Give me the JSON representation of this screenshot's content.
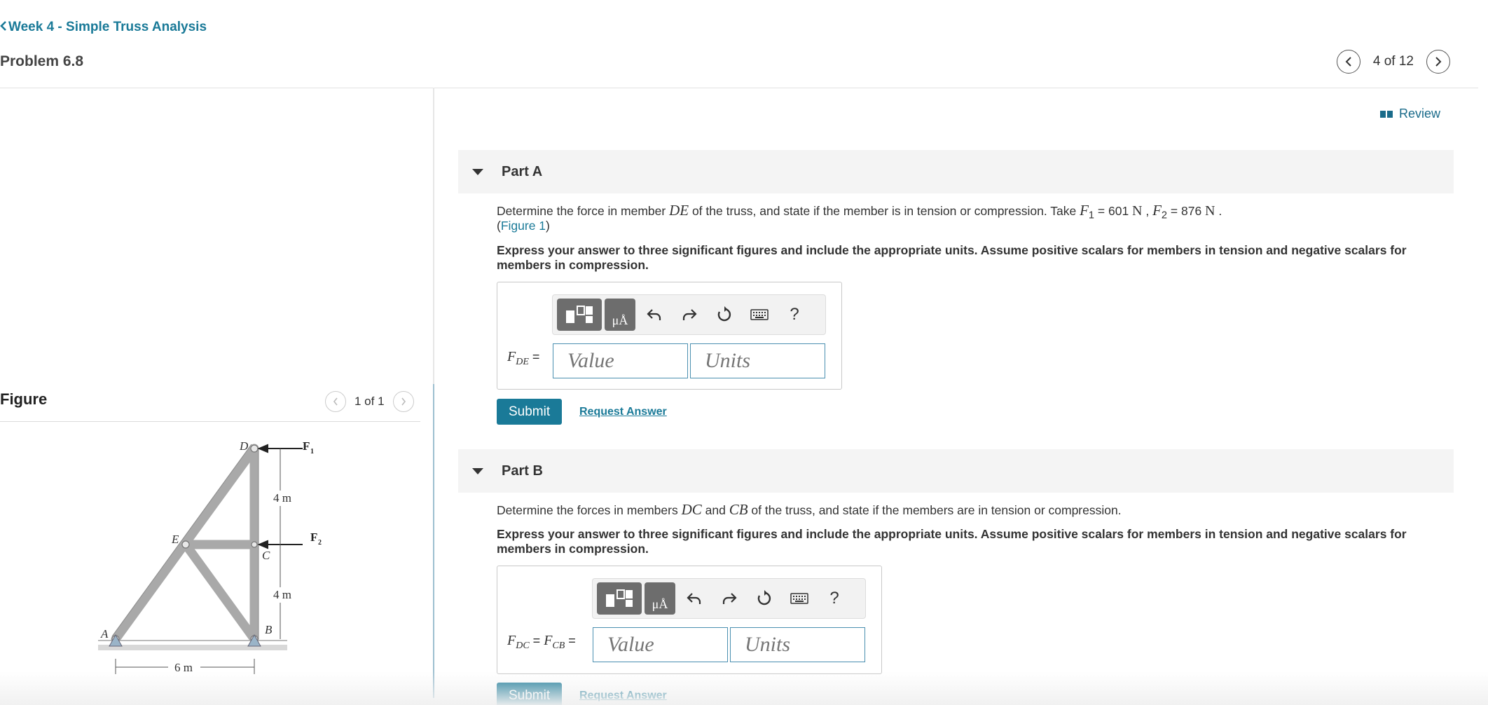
{
  "breadcrumb": {
    "label": "Week 4 - Simple Truss Analysis"
  },
  "problem": {
    "title": "Problem 6.8"
  },
  "pager": {
    "text": "4 of 12"
  },
  "review": {
    "label": "Review"
  },
  "figure_panel": {
    "title": "Figure",
    "pager_text": "1 of 1",
    "labels": {
      "D": "D",
      "E": "E",
      "C": "C",
      "A": "A",
      "B": "B",
      "F1": "F",
      "F1_sub": "1",
      "F2": "F",
      "F2_sub": "2",
      "dim_top": "4 m",
      "dim_bottom": "4 m",
      "dim_base": "6 m"
    }
  },
  "partA": {
    "label": "Part A",
    "q_pre": "Determine the force in member ",
    "q_member": "DE",
    "q_mid": " of the truss, and state if the member is in tension or compression. Take ",
    "f1_sym": "F",
    "f1_sub": "1",
    "f1_val": " = 601 ",
    "f1_unit": "N",
    "sep": " , ",
    "f2_sym": "F",
    "f2_sub": "2",
    "f2_val": " = 876 ",
    "f2_unit": "N",
    "q_end": " .",
    "fig_open": "(",
    "fig_link": "Figure 1",
    "fig_close": ")",
    "instruction": "Express your answer to three significant figures and include the appropriate units. Assume positive scalars for members in tension and negative scalars for members in compression.",
    "eq_sym": "F",
    "eq_sub": "DE",
    "eq_equals": " =",
    "value_placeholder": "Value",
    "units_placeholder": "Units",
    "submit": "Submit",
    "request": "Request Answer"
  },
  "partB": {
    "label": "Part B",
    "q_pre": "Determine the forces in members ",
    "m1": "DC",
    "and": " and ",
    "m2": "CB",
    "q_end": " of the truss, and state if the members are in tension or compression.",
    "instruction": "Express your answer to three significant figures and include the appropriate units. Assume positive scalars for members in tension and negative scalars for members in compression.",
    "eq_sym1": "F",
    "eq_sub1": "DC",
    "eq_mid": " = ",
    "eq_sym2": "F",
    "eq_sub2": "CB",
    "eq_equals": " =",
    "value_placeholder": "Value",
    "units_placeholder": "Units",
    "submit": "Submit",
    "request": "Request Answer"
  },
  "toolbar": {
    "units_tile": "μÅ",
    "help": "?"
  },
  "colors": {
    "accent": "#1a7a98",
    "tile": "#6d6d6d"
  }
}
